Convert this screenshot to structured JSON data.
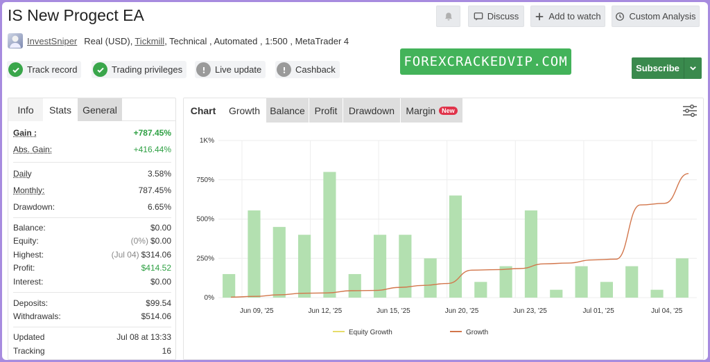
{
  "header": {
    "title": "IS New Progect EA",
    "discuss_label": "Discuss",
    "add_watch_label": "Add to watch",
    "custom_analysis_label": "Custom Analysis"
  },
  "account": {
    "username": "InvestSniper",
    "type": "Real (USD),",
    "broker": "Tickmill",
    "rest": ", Technical , Automated , 1:500 , MetaTrader 4"
  },
  "badges": [
    {
      "label": "Track record",
      "status": "ok"
    },
    {
      "label": "Trading privileges",
      "status": "ok"
    },
    {
      "label": "Live update",
      "status": "na"
    },
    {
      "label": "Cashback",
      "status": "na"
    }
  ],
  "watermark": "FOREXCRACKEDVIP.COM",
  "subscribe_label": "Subscribe",
  "left_tabs": [
    "Info",
    "Stats",
    "General"
  ],
  "stats": {
    "gain": {
      "label": "Gain :",
      "value": "+787.45%"
    },
    "abs_gain": {
      "label": "Abs. Gain:",
      "value": "+416.44%"
    },
    "daily": {
      "label": "Daily",
      "value": "3.58%"
    },
    "monthly": {
      "label": "Monthly:",
      "value": "787.45%"
    },
    "drawdown": {
      "label": "Drawdown:",
      "value": "6.65%"
    },
    "balance": {
      "label": "Balance:",
      "value": "$0.00"
    },
    "equity": {
      "label": "Equity:",
      "value": "$0.00",
      "note": "(0%)"
    },
    "highest": {
      "label": "Highest:",
      "value": "$314.06",
      "note": "(Jul 04)"
    },
    "profit": {
      "label": "Profit:",
      "value": "$414.52"
    },
    "interest": {
      "label": "Interest:",
      "value": "$0.00"
    },
    "deposits": {
      "label": "Deposits:",
      "value": "$99.54"
    },
    "withdrawals": {
      "label": "Withdrawals:",
      "value": "$514.06"
    },
    "updated": {
      "label": "Updated",
      "value": "Jul 08 at 13:33"
    },
    "tracking": {
      "label": "Tracking",
      "value": "16"
    }
  },
  "chart_tabs": {
    "chart": "Chart",
    "growth": "Growth",
    "balance": "Balance",
    "profit": "Profit",
    "drawdown": "Drawdown",
    "margin": "Margin",
    "new_badge": "New"
  },
  "colors": {
    "bar": "#b3e0b0",
    "growth_line": "#d2754a",
    "equity_line": "#e6dc6a",
    "accent_green": "#3a8a4d"
  },
  "chart_data": {
    "type": "bar",
    "ylim": [
      0,
      1000
    ],
    "yticks": [
      0,
      250,
      500,
      750,
      1000
    ],
    "ytick_labels": [
      "0%",
      "250%",
      "500%",
      "750%",
      "1K%"
    ],
    "xtick_labels": [
      "Jun 09, '25",
      "Jun 12, '25",
      "Jun 15, '25",
      "Jun 20, '25",
      "Jun 23, '25",
      "Jul 01, '25",
      "Jul 04, '25"
    ],
    "series": [
      {
        "name": "Equity Growth",
        "type": "line",
        "values": []
      },
      {
        "name": "Growth",
        "type": "line",
        "values": [
          3,
          8,
          18,
          28,
          30,
          44,
          46,
          65,
          78,
          90,
          175,
          178,
          185,
          215,
          220,
          240,
          245,
          590,
          600,
          790
        ]
      }
    ],
    "bars": [
      150,
      555,
      450,
      400,
      800,
      150,
      400,
      400,
      250,
      650,
      100,
      200,
      555,
      50,
      200,
      100,
      200,
      50,
      250
    ],
    "legend": [
      "Equity Growth",
      "Growth"
    ]
  }
}
